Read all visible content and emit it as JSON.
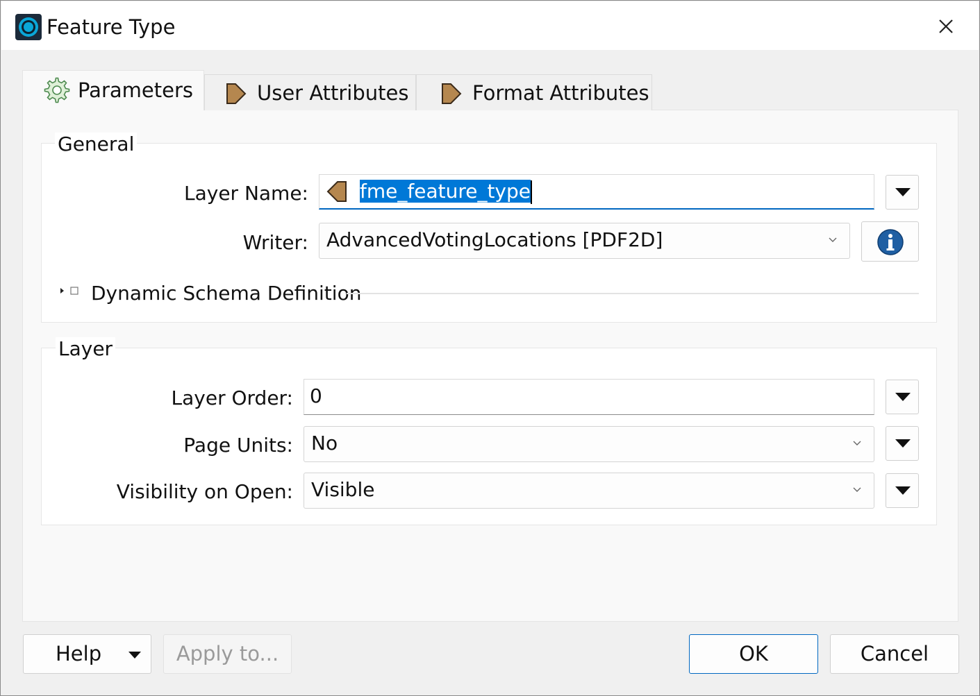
{
  "window": {
    "title": "Feature Type",
    "close_icon": "close-icon",
    "app_icon": "fme-app-icon"
  },
  "tabs": [
    {
      "label": "Parameters",
      "icon": "gear-icon",
      "active": true
    },
    {
      "label": "User Attributes",
      "icon": "arrow-right-icon",
      "active": false
    },
    {
      "label": "Format Attributes",
      "icon": "arrow-right-icon",
      "active": false
    }
  ],
  "general": {
    "title": "General",
    "layer_name": {
      "label": "Layer Name:",
      "value": "fme_feature_type"
    },
    "writer": {
      "label": "Writer:",
      "value": "AdvancedVotingLocations [PDF2D]"
    },
    "dynamic_schema": {
      "label": "Dynamic Schema Definition",
      "expanded": false
    }
  },
  "layer": {
    "title": "Layer",
    "layer_order": {
      "label": "Layer Order:",
      "value": "0"
    },
    "page_units": {
      "label": "Page Units:",
      "value": "No"
    },
    "visibility": {
      "label": "Visibility on Open:",
      "value": "Visible"
    }
  },
  "buttons": {
    "help": "Help",
    "apply_to": "Apply to...",
    "ok": "OK",
    "cancel": "Cancel"
  },
  "colors": {
    "accent": "#0067c0",
    "selection": "#0078d7",
    "attribute_arrow": "#b5874f",
    "info_icon": "#1f5fa3"
  }
}
